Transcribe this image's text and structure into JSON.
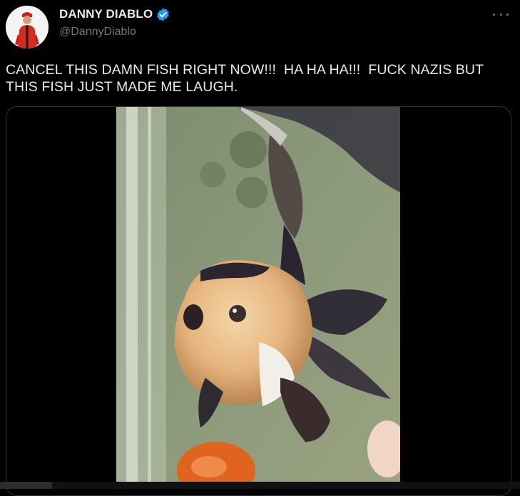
{
  "author": {
    "display_name": "DANNY DIABLO",
    "handle": "@DannyDiablo",
    "verified": true,
    "verified_icon": "verified-badge-icon",
    "verified_color": "#1d9bf0"
  },
  "more_icon": "more-horizontal-icon",
  "tweet": {
    "text": "CANCEL THIS DAMN FISH RIGHT NOW!!!  HA HA HA!!!  FUCK NAZIS BUT THIS FISH JUST MADE ME LAUGH."
  },
  "media": {
    "type": "video",
    "progress_fraction": 0.1
  },
  "colors": {
    "background": "#000000",
    "text": "#e7e9ea",
    "secondary": "#71767b",
    "border": "#2f3336"
  }
}
